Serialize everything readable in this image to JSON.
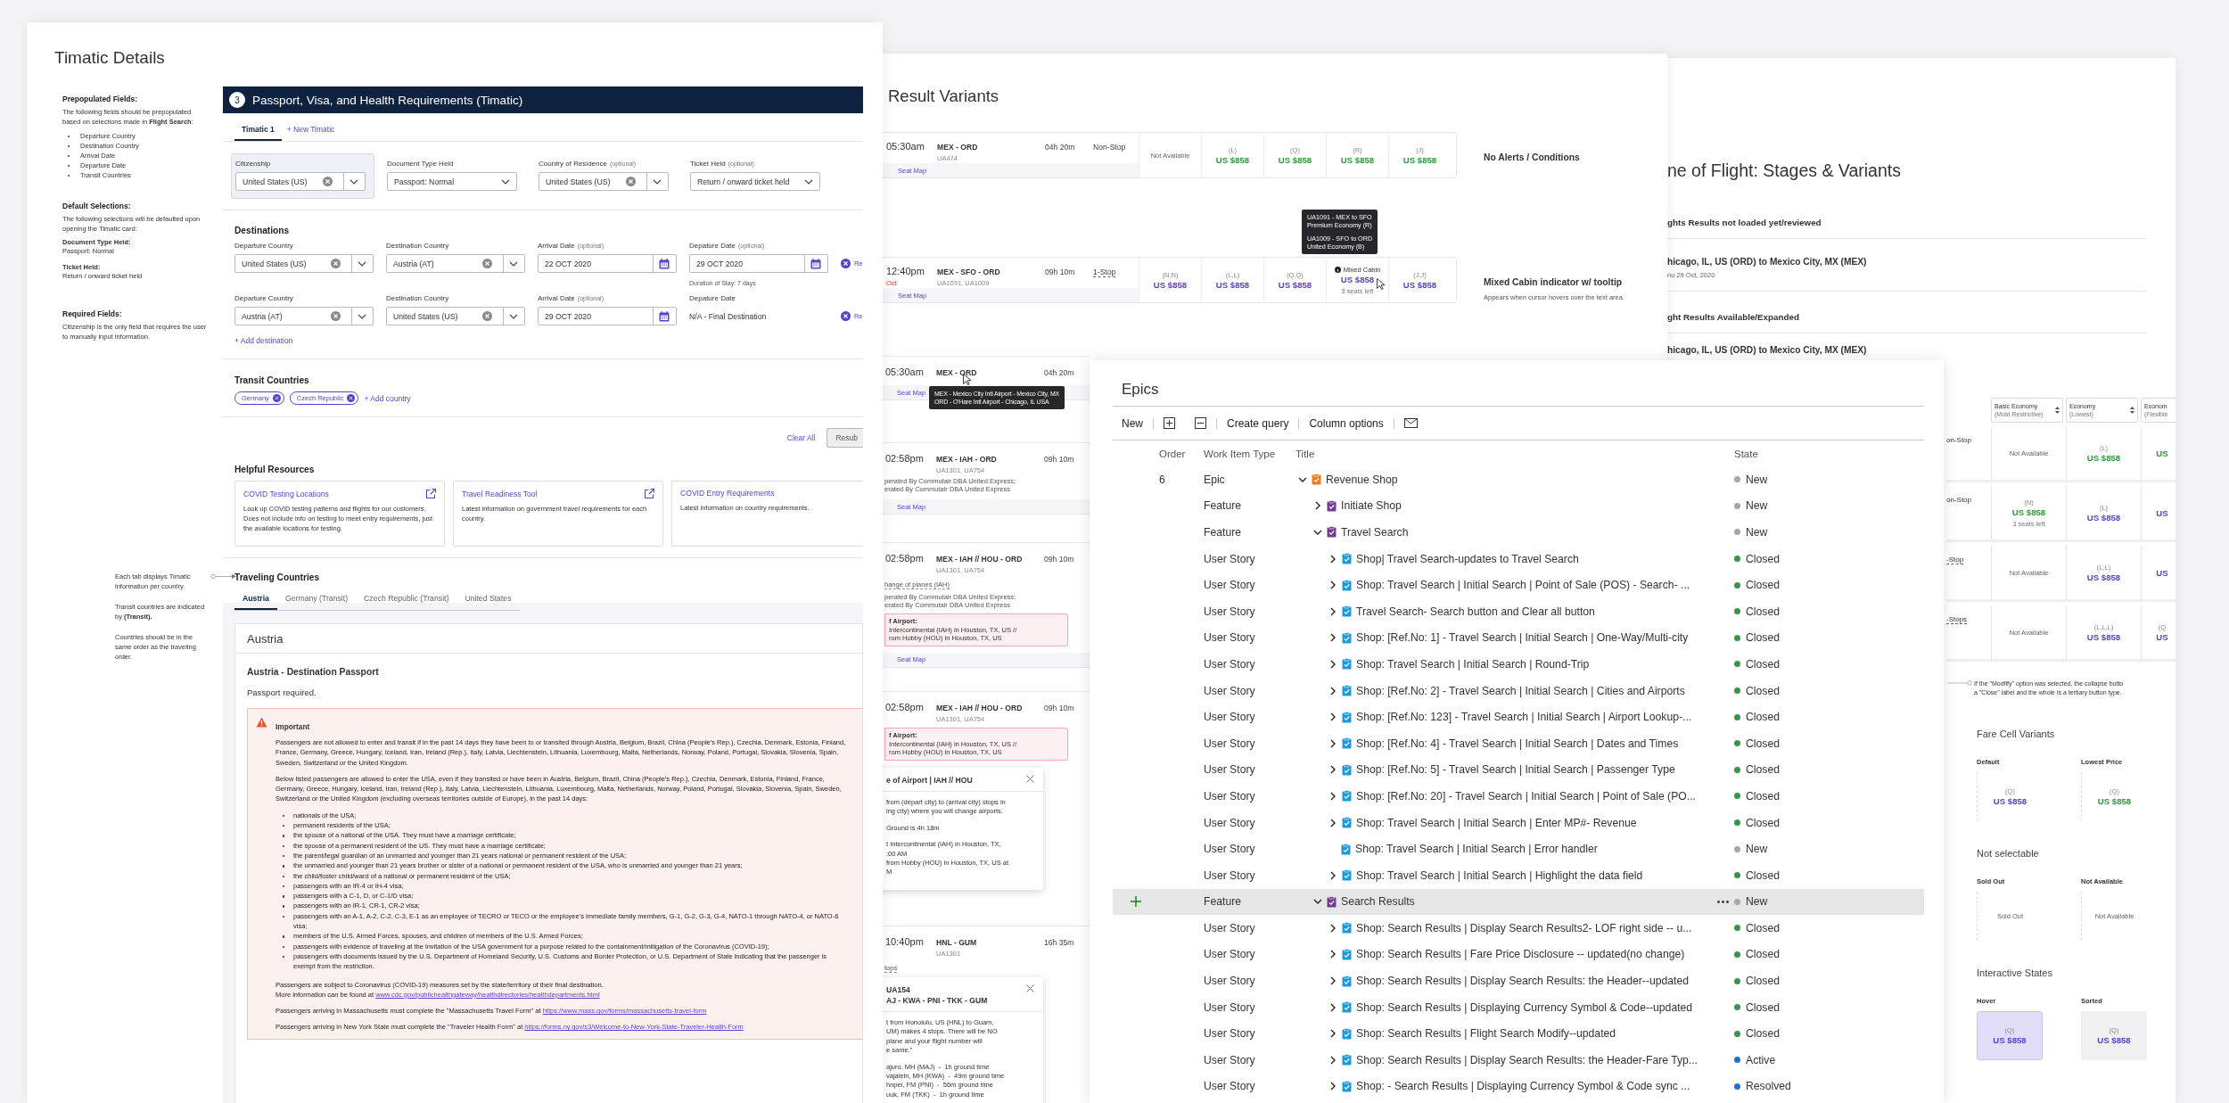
{
  "timatic": {
    "title": "Timatic Details",
    "notes": [
      {
        "heading": "Prepopulated Fields:",
        "text": "The following fields should be prepopulated based on selections made in **Flight Search**:",
        "bullets": [
          "Departure Country",
          "Destination Country",
          "Arrival Date",
          "Departure Date",
          "Transit Countries"
        ]
      },
      {
        "heading": "Default Selections:",
        "text": "The following selections will be defaulted upon opening the Timatic card:",
        "pairs": [
          {
            "label": "Document Type Held:",
            "value": "Passport: Normal"
          },
          {
            "label": "Ticket Held:",
            "value": "Return / onward ticket held"
          }
        ]
      },
      {
        "heading": "Required Fields:",
        "text": "Citizenship is the only field that requires the user to manually input information."
      }
    ],
    "tab_notes": [
      "Each tab displays Timatic information per country.",
      "Transit countries are indicated by **(Transit).**",
      "Countries should be in the same order as the traveling order."
    ],
    "card": {
      "step": "3",
      "title": "Passport, Visa, and Health Requirements (Timatic)",
      "tabs": [
        {
          "label": "Timatic 1",
          "selected": true
        }
      ],
      "new_tab": "+ New Timatic",
      "fields": [
        {
          "kind": "select",
          "label": "Citizenship",
          "value": "United States (US)",
          "clearable": true,
          "highlighted": true
        },
        {
          "kind": "select",
          "label": "Document Type Held",
          "value": "Passport: Normal",
          "clearable": false,
          "highlighted": false
        },
        {
          "kind": "select",
          "label": "Country of Residence",
          "optional": "(optional)",
          "value": "United States (US)",
          "clearable": true,
          "highlighted": false
        },
        {
          "kind": "select",
          "label": "Ticket Held",
          "optional": "(optional)",
          "value": "Return / onward ticket held",
          "clearable": false,
          "highlighted": false
        }
      ],
      "destinations_title": "Destinations",
      "destinations": [
        {
          "fields": [
            {
              "kind": "select",
              "label": "Departure Country",
              "value": "United States (US)",
              "clearable": true
            },
            {
              "kind": "select",
              "label": "Destination Country",
              "value": "Austria (AT)",
              "clearable": true
            },
            {
              "kind": "date",
              "label": "Arrival Date",
              "optional": "(optional)",
              "value": "22 OCT 2020"
            },
            {
              "kind": "date",
              "label": "Depature Date",
              "optional": "(optional)",
              "value": "29 OCT 2020",
              "hint": "Duration of Stay: 7 days"
            }
          ],
          "remove": "Re"
        },
        {
          "fields": [
            {
              "kind": "select",
              "label": "Departure Country",
              "value": "Austria (AT)",
              "clearable": true
            },
            {
              "kind": "select",
              "label": "Destination Country",
              "value": "United States (US)",
              "clearable": true
            },
            {
              "kind": "date",
              "label": "Arrival Date",
              "optional": "(optional)",
              "value": "29 OCT 2020"
            },
            {
              "kind": "static",
              "label": "Depature Date",
              "value": "N/A - Final Destination"
            }
          ],
          "remove": "Re"
        }
      ],
      "add_destination": "+ Add destination",
      "transit_title": "Transit Countries",
      "transit_chips": [
        "Germany",
        "Czech Republic"
      ],
      "add_country": "+ Add country",
      "clear_all": "Clear All",
      "resubmit": "Resub",
      "resources_title": "Helpful Resources",
      "resources": [
        {
          "title": "COVID Testing Locations",
          "text": "Look up COVID testing patterns and flights for our customers. Does not include info on testing to meet entry requirements, just the available locations for testing.",
          "external": true
        },
        {
          "title": "Travel Readiness Tool",
          "text": "Latest information on government travel requirements for each country.",
          "external": true
        },
        {
          "title": "COVID Entry Requirements",
          "text": "Latest information on country requirements.",
          "external": false
        }
      ],
      "countries_title": "Traveling Countries",
      "country_tabs": [
        {
          "label": "Austria",
          "selected": true
        },
        {
          "label": "Germany (Transit)",
          "selected": false
        },
        {
          "label": "Czech Republic (Transit)",
          "selected": false
        },
        {
          "label": "United States",
          "selected": false
        }
      ],
      "country": {
        "name": "Austria",
        "section": "Austria - Destination Passport",
        "summary": "Passport required.",
        "alert": {
          "title": "Important",
          "before": [
            "Passengers are not allowed to enter and transit if in the past 14 days they have been to or transited through Austria, Belgium, Brazil, China (People's Rep.), Czechia, Denmark, Estonia, Finland, France, Germany, Greece, Hungary, Iceland, Iran, Ireland (Rep.), Italy, Latvia, Liechtenstein, Lithuania, Luxembourg, Malta, Netherlands, Norway, Poland, Portugal, Slovakia, Slovenia, Spain, Sweden, Switzerland or the United Kingdom.",
            "Below listed passengers are allowed to enter the USA, even if they transited or have been in Austria, Belgium, Brazil, China (People's Rep.), Czechia, Denmark, Estonia, Finland, France, Germany, Greece, Hungary, Iceland, Iran, Ireland (Rep.), Italy, Latvia, Liechtenstein, Lithuania, Luxembourg, Malta, Netherlands, Norway, Poland, Portugal, Slovakia, Slovenia, Spain, Sweden, Switzerland or the United Kingdom (excluding overseas territories outside of Europe), in the past 14 days:"
          ],
          "bullets": [
            "nationals of the USA;",
            "permanent residents of the USA;",
            "the spouse of a national of the USA. They must have a marriage certificate;",
            "the spouse of a permanent resident of the US. They must have a marriage certificate;",
            "the parent/legal guardian of an unmarried and younger than 21 years national or permanent resident of the USA;",
            "the unmarried and younger than 21 years brother or sister of a national or permanent resident of the USA, who is unmarried and younger than 21 years;",
            "the child/foster child/ward of a national or permanent resident of the USA;",
            "passengers with an IR-4 or IH-4 visa;",
            "passengers with a C-1, D, or C-1/D visa;",
            "passengers with an IR-1, CR-1, CR-2 visa;",
            "passengers with an A-1, A-2, C-2, C-3, E-1 as an employee of TECRO or TECO or the employee's immediate family members, G-1, G-2, G-3, G-4, NATO-1 through NATO-4, or NATO-6 visa;",
            "members of the U.S. Armed Forces, spouses, and children of members of the U.S. Armed Forces;",
            "passengers with evidence of traveling at the invitation of the USA government for a purpose related to the containment/mitigation of the Coronavirus (COVID-19);",
            "passengers with documents issued by the U.S. Department of Homeland Security, U.S. Customs and Border Protection, or U.S. Department of State indicating that the passenger is exempt from the restriction."
          ],
          "after": [
            {
              "lines": [
                {
                  "text": "Passengers are subject to Coronavirus (COVID-19) measures set by the state/territory of their final destination."
                },
                {
                  "text": "More information can be found at",
                  "link": "www.cdc.gov/publichealthgateway/healthdirectories/healthdepartments.html"
                }
              ]
            },
            {
              "lines": [
                {
                  "text": "Passengers arriving in Massachusetts must complete the \"Massachusetts Travel Form\" at",
                  "link": "https://www.mass.gov/forms/massachusetts-travel-form"
                }
              ]
            },
            {
              "lines": [
                {
                  "text": "Passengers arriving in New York State must complete the \"Traveler Health Form\" at",
                  "link": "https://forms.ny.gov/s3/Welcome-to-New-York-State-Traveler-Health-Form"
                }
              ]
            }
          ]
        }
      }
    }
  },
  "flights": {
    "title": "Result Variants",
    "rows": [
      {
        "time": "05:30am",
        "route": "MEX - ORD",
        "flights": "UA474",
        "duration": "04h 20m",
        "stops": "Non-Stop",
        "dashed": false,
        "seat_map": "Seat Map",
        "fares": [
          {
            "kind": "text",
            "text": "Not Available"
          },
          {
            "kind": "price",
            "code": "(L)",
            "price": "US $858",
            "color": "#2e9a3a"
          },
          {
            "kind": "price",
            "code": "(Q)",
            "price": "US $858",
            "color": "#2e9a3a"
          },
          {
            "kind": "price",
            "code": "(R)",
            "price": "US $858",
            "color": "#2e9a3a"
          },
          {
            "kind": "price",
            "code": "(J)",
            "price": "US $858",
            "color": "#2e9a3a"
          }
        ],
        "note": "No Alerts / Conditions"
      },
      {
        "time": "12:40pm",
        "date_note": "Oct",
        "route": "MEX - SFO - ORD",
        "flights": "UA1091, UA1009",
        "duration": "09h 10m",
        "stops": "1-Stop",
        "dashed": true,
        "seat_map": "Seat Map",
        "cursor": true,
        "fares": [
          {
            "kind": "price",
            "code": "(N,N)",
            "price": "US $858",
            "color": "#5b3fd1"
          },
          {
            "kind": "price",
            "code": "(L,L)",
            "price": "US $858",
            "color": "#5b3fd1"
          },
          {
            "kind": "price",
            "code": "(Q,Q)",
            "price": "US $858",
            "color": "#5b3fd1"
          },
          {
            "kind": "mixed",
            "code": "Mixed Cabin",
            "price": "US $858",
            "color": "#5b3fd1",
            "seats": "3 seats left"
          },
          {
            "kind": "price",
            "code": "(J,J)",
            "price": "US $858",
            "color": "#5b3fd1"
          }
        ],
        "tooltip": [
          [
            "UA1091 - MEX to SFO",
            "Premium Economy (R)"
          ],
          [
            "UA1009 - SFO to ORD",
            "United Economy (B)"
          ]
        ],
        "note": "Mixed Cabin indicator w/ tooltip",
        "note_sub": "Appears when cursor hovers over the text area."
      }
    ],
    "partial_rows": [
      {
        "time": "05:30am",
        "route": "MEX - ORD",
        "duration": "04h 20m",
        "seat_map": "Seat Map",
        "cursor": true,
        "tooltip": [
          "MEX - Mexico City Intl Airport - Mexico City, MX",
          "ORD - O'Hare Intl Airport - Chicago, IL USA"
        ]
      },
      {
        "time": "02:58pm",
        "route": "MEX - IAH - ORD",
        "flights": "UA1301, UA754",
        "duration": "09h 10m",
        "operators": [
          "perated By Commutair DBA United Express;",
          "erated By Commutair DBA United Express"
        ],
        "seat_map": "Seat Map"
      },
      {
        "time": "02:58pm",
        "route": "MEX - IAH // HOU - ORD",
        "flights": "UA1301, UA754",
        "duration": "09h 10m",
        "change": "hange of planes (IAH)",
        "operators": [
          "perated By Commutair DBA United Express;",
          "erated By Commutair DBA United Express"
        ],
        "alert": [
          "f Airport:",
          "Intercontinental (IAH) in Houston, TX, US //",
          "rom Hobby (HOU) in Houston, TX, US"
        ],
        "seat_map": "Seat Map"
      },
      {
        "time": "02:58pm",
        "route": "MEX - IAH // HOU - ORD",
        "flights": "UA1301, UA754",
        "duration": "09h 10m",
        "alert": [
          "f Airport:",
          "Intercontinental (IAH) in Houston, TX, US //",
          "rom Hobby (HOU) in Houston, TX, US"
        ],
        "popover": {
          "title": [
            "e of Airport | IAH // HOU"
          ],
          "paragraphs": [
            [
              "from (depart city) to (arrival city) stops in",
              "ing city) where you will change airports."
            ],
            [
              "Ground is 4h 18m"
            ],
            [
              "t Intercontinental (IAH) in Houston, TX,",
              ":00 AM",
              "from Hobby (HOU) in Houston, TX, US at",
              "M"
            ]
          ]
        }
      },
      {
        "time": "10:40pm",
        "route": "HNL - GUM",
        "flights": "UA1301",
        "duration": "16h 35m",
        "change": "tops",
        "popover": {
          "title": [
            "UA154",
            "AJ - KWA - PNI - TKK - GUM"
          ],
          "paragraphs": [
            [
              "t from Honolulu, US (HNL) to Guam,",
              "UM) makes 4 stops. There will be NO",
              "plane and your flight number will",
              "e same.\""
            ],
            [
              "ajuro, MH (MAJ)  -  1h ground time",
              "vajalein, MH (KWA)  -  49m ground time",
              "hnpei, FM (PNI)  -  56m ground time",
              "uuk, FM (TKK)  -  1h ground time"
            ]
          ]
        }
      }
    ]
  },
  "stages": {
    "title": "ne of Flight: Stages & Variants",
    "blocks": [
      {
        "heading": "ghts Results not loaded yet/reviewed",
        "route": "hicago, IL, US (ORD) to Mexico City, MX (MEX)",
        "date": "nu 29 Oct, 2020"
      },
      {
        "heading": "ght Results Available/Expanded",
        "route": "hicago, IL, US (ORD) to Mexico City, MX (MEX)"
      }
    ],
    "table": {
      "columns": [
        {
          "title": "Basic Economy",
          "sub": "(Most Restrictive)",
          "sortable": true
        },
        {
          "title": "Economy",
          "sub": "(Lowest)",
          "sortable": true
        },
        {
          "title": "Econom",
          "sub": "(Flexible",
          "sortable": false
        }
      ],
      "rows": [
        {
          "stops": "on-Stop",
          "dashed": false,
          "cells": [
            {
              "kind": "text",
              "text": "Not Available"
            },
            {
              "kind": "price",
              "code": "(L)",
              "price": "US $858",
              "color": "#2e9a3a"
            },
            {
              "kind": "price",
              "price": "US",
              "color": "#2e9a3a"
            }
          ]
        },
        {
          "stops": "on-Stop",
          "dashed": false,
          "cells": [
            {
              "kind": "price",
              "code": "(N)",
              "price": "US $858",
              "color": "#2e9a3a",
              "seats": "3 seats left"
            },
            {
              "kind": "price",
              "code": "(L)",
              "price": "US $858",
              "color": "#5b3fd1"
            },
            {
              "kind": "price",
              "price": "US",
              "color": "#5b3fd1"
            }
          ]
        },
        {
          "stops": "-Stop",
          "dashed": true,
          "cells": [
            {
              "kind": "text",
              "text": "Not Available"
            },
            {
              "kind": "price",
              "code": "(L,L)",
              "price": "US $858",
              "color": "#5b3fd1"
            },
            {
              "kind": "price",
              "price": "US",
              "color": "#5b3fd1"
            }
          ]
        },
        {
          "stops": "-Stops",
          "dashed": true,
          "cells": [
            {
              "kind": "text",
              "text": "Not Available"
            },
            {
              "kind": "price",
              "code": "(L,L,L)",
              "price": "US $858",
              "color": "#5b3fd1"
            },
            {
              "kind": "price",
              "code": "(Q",
              "price": "US",
              "color": "#5b3fd1"
            }
          ]
        }
      ]
    },
    "annotation": [
      "If the \"Modfify\" option was selected, the collapse butto",
      "a \"Close\" label and the whole is a tertiary button type."
    ],
    "variants": [
      {
        "title": "Fare Cell Variants",
        "items": [
          {
            "label": "Default",
            "kind": "price",
            "code": "(Q)",
            "price": "US $858",
            "color": "#5b3fd1",
            "hovered": false,
            "sorted": false
          },
          {
            "label": "Lowest Price",
            "kind": "price",
            "code": "(Q)",
            "price": "US $858",
            "color": "#2e9a3a",
            "hovered": false,
            "sorted": false
          }
        ]
      },
      {
        "title": "Not selectable",
        "items": [
          {
            "label": "Sold Out",
            "kind": "text",
            "text": "Sold Out",
            "hovered": false,
            "sorted": false
          },
          {
            "label": "Not Available",
            "kind": "text",
            "text": "Not Available",
            "hovered": false,
            "sorted": false
          }
        ]
      },
      {
        "title": "Interactive States",
        "items": [
          {
            "label": "Hover",
            "kind": "price",
            "code": "(Q)",
            "price": "US $858",
            "color": "#5b3fd1",
            "hovered": true,
            "sorted": false
          },
          {
            "label": "Sorted",
            "kind": "price",
            "code": "(Q)",
            "price": "US $858",
            "color": "#5b3fd1",
            "hovered": false,
            "sorted": true
          }
        ]
      }
    ]
  },
  "epics": {
    "title": "Epics",
    "toolbar": [
      {
        "kind": "text",
        "label": "New"
      },
      {
        "kind": "expand"
      },
      {
        "kind": "collapse"
      },
      {
        "kind": "text",
        "label": "Create query"
      },
      {
        "kind": "text",
        "label": "Column options"
      },
      {
        "kind": "mail"
      }
    ],
    "columns": [
      "Order",
      "Work Item Type",
      "Title",
      "State"
    ],
    "rows": [
      {
        "order": "6",
        "type": "Epic",
        "title": "Revenue Shop",
        "color": "#f07d1e",
        "expandable": true,
        "expanded": true,
        "selected": false,
        "state": {
          "label": "New",
          "color": "#a6a6a6"
        },
        "children": [
          {
            "type": "Feature",
            "title": "Initiate Shop",
            "color": "#773b93",
            "expandable": true,
            "expanded": false,
            "selected": false,
            "state": {
              "label": "New",
              "color": "#a6a6a6"
            }
          },
          {
            "type": "Feature",
            "title": "Travel Search",
            "color": "#773b93",
            "expandable": true,
            "expanded": true,
            "selected": false,
            "state": {
              "label": "New",
              "color": "#a6a6a6"
            },
            "children": [
              {
                "type": "User Story",
                "title": "Shop| Travel Search-updates to Travel Search",
                "color": "#1e9bd7",
                "expandable": true,
                "expanded": false,
                "selected": false,
                "state": {
                  "label": "Closed",
                  "color": "#339947"
                }
              },
              {
                "type": "User Story",
                "title": "Shop: Travel Search | Initial Search | Point of Sale (POS) - Search- ...",
                "color": "#1e9bd7",
                "expandable": true,
                "expanded": false,
                "selected": false,
                "state": {
                  "label": "Closed",
                  "color": "#339947"
                }
              },
              {
                "type": "User Story",
                "title": "Travel Search- Search button and Clear all button",
                "color": "#1e9bd7",
                "expandable": true,
                "expanded": false,
                "selected": false,
                "state": {
                  "label": "Closed",
                  "color": "#339947"
                }
              },
              {
                "type": "User Story",
                "title": "Shop: [Ref.No: 1] - Travel Search | Initial Search | One-Way/Multi-city",
                "color": "#1e9bd7",
                "expandable": true,
                "expanded": false,
                "selected": false,
                "state": {
                  "label": "Closed",
                  "color": "#339947"
                }
              },
              {
                "type": "User Story",
                "title": "Shop: Travel Search | Initial Search | Round-Trip",
                "color": "#1e9bd7",
                "expandable": true,
                "expanded": false,
                "selected": false,
                "state": {
                  "label": "Closed",
                  "color": "#339947"
                }
              },
              {
                "type": "User Story",
                "title": "Shop: [Ref.No: 2] - Travel Search | Initial Search | Cities and Airports",
                "color": "#1e9bd7",
                "expandable": true,
                "expanded": false,
                "selected": false,
                "state": {
                  "label": "Closed",
                  "color": "#339947"
                }
              },
              {
                "type": "User Story",
                "title": "Shop: [Ref.No: 123] - Travel Search | Initial Search | Airport Lookup-...",
                "color": "#1e9bd7",
                "expandable": true,
                "expanded": false,
                "selected": false,
                "state": {
                  "label": "Closed",
                  "color": "#339947"
                }
              },
              {
                "type": "User Story",
                "title": "Shop: [Ref.No: 4] - Travel Search | Initial Search | Dates and Times",
                "color": "#1e9bd7",
                "expandable": true,
                "expanded": false,
                "selected": false,
                "state": {
                  "label": "Closed",
                  "color": "#339947"
                }
              },
              {
                "type": "User Story",
                "title": "Shop: [Ref.No: 5] - Travel Search | Initial Search | Passenger Type",
                "color": "#1e9bd7",
                "expandable": true,
                "expanded": false,
                "selected": false,
                "state": {
                  "label": "Closed",
                  "color": "#339947"
                }
              },
              {
                "type": "User Story",
                "title": "Shop: [Ref.No: 20] - Travel Search | Initial Search | Point of Sale (PO...",
                "color": "#1e9bd7",
                "expandable": true,
                "expanded": false,
                "selected": false,
                "state": {
                  "label": "Closed",
                  "color": "#339947"
                }
              },
              {
                "type": "User Story",
                "title": "Shop: Travel Search | Initial Search | Enter MP#- Revenue",
                "color": "#1e9bd7",
                "expandable": true,
                "expanded": false,
                "selected": false,
                "state": {
                  "label": "Closed",
                  "color": "#339947"
                }
              },
              {
                "type": "User Story",
                "title": "Shop: Travel Search | Initial Search | Error handler",
                "color": "#1e9bd7",
                "expandable": false,
                "selected": false,
                "state": {
                  "label": "New",
                  "color": "#a6a6a6"
                }
              },
              {
                "type": "User Story",
                "title": "Shop: Travel Search | Initial Search | Highlight the data field",
                "color": "#1e9bd7",
                "expandable": true,
                "expanded": false,
                "selected": false,
                "state": {
                  "label": "Closed",
                  "color": "#339947"
                }
              }
            ]
          },
          {
            "type": "Feature",
            "title": "Search Results",
            "color": "#773b93",
            "expandable": true,
            "expanded": true,
            "selected": true,
            "state": {
              "label": "New",
              "color": "#a6a6a6"
            },
            "children": [
              {
                "type": "User Story",
                "title": "Shop: Search Results | Display Search Results2- LOF right side -- u...",
                "color": "#1e9bd7",
                "expandable": true,
                "expanded": false,
                "selected": false,
                "state": {
                  "label": "Closed",
                  "color": "#339947"
                }
              },
              {
                "type": "User Story",
                "title": "Shop: Search Results | Fare Price Disclosure -- updated(no change)",
                "color": "#1e9bd7",
                "expandable": true,
                "expanded": false,
                "selected": false,
                "state": {
                  "label": "Closed",
                  "color": "#339947"
                }
              },
              {
                "type": "User Story",
                "title": "Shop: Search Results | Display Search Results: the Header--updated",
                "color": "#1e9bd7",
                "expandable": true,
                "expanded": false,
                "selected": false,
                "state": {
                  "label": "Closed",
                  "color": "#339947"
                }
              },
              {
                "type": "User Story",
                "title": "Shop: Search Results | Displaying Currency Symbol & Code--updated",
                "color": "#1e9bd7",
                "expandable": true,
                "expanded": false,
                "selected": false,
                "state": {
                  "label": "Closed",
                  "color": "#339947"
                }
              },
              {
                "type": "User Story",
                "title": "Shop: Search Results | Flight Search Modify--updated",
                "color": "#1e9bd7",
                "expandable": true,
                "expanded": false,
                "selected": false,
                "state": {
                  "label": "Closed",
                  "color": "#339947"
                }
              },
              {
                "type": "User Story",
                "title": "Shop: Search Results | Display Search Results: the Header-Fare Typ...",
                "color": "#1e9bd7",
                "expandable": true,
                "expanded": false,
                "selected": false,
                "state": {
                  "label": "Active",
                  "color": "#1a73d0"
                }
              },
              {
                "type": "User Story",
                "title": "Shop: - Search Results | Displaying Currency Symbol & Code sync ...",
                "color": "#1e9bd7",
                "expandable": true,
                "expanded": false,
                "selected": false,
                "state": {
                  "label": "Resolved",
                  "color": "#1a73d0"
                }
              }
            ]
          }
        ]
      }
    ]
  }
}
